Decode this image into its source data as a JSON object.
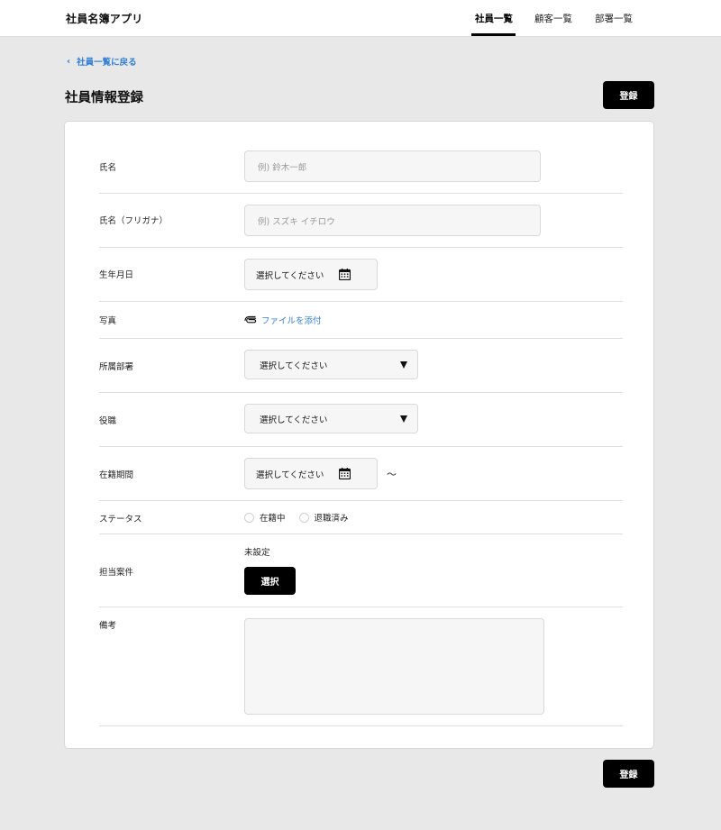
{
  "header": {
    "app_title": "社員名簿アプリ",
    "tabs": [
      {
        "label": "社員一覧",
        "active": true
      },
      {
        "label": "顧客一覧",
        "active": false
      },
      {
        "label": "部署一覧",
        "active": false
      }
    ]
  },
  "back_link": {
    "icon": "chevron-left",
    "label": "社員一覧に戻る"
  },
  "page_title": "社員情報登録",
  "register_button": "登録",
  "form": {
    "name": {
      "label": "氏名",
      "placeholder": "例) 鈴木一郎"
    },
    "name_kana": {
      "label": "氏名（フリガナ）",
      "placeholder": "例) スズキ イチロウ"
    },
    "birthdate": {
      "label": "生年月日",
      "value": "選択してください",
      "icon": "calendar-icon"
    },
    "photo": {
      "label": "写真",
      "attach_label": "ファイルを添付",
      "icon": "paperclip-icon"
    },
    "department": {
      "label": "所属部署",
      "value": "選択してください"
    },
    "position": {
      "label": "役職",
      "value": "選択してください"
    },
    "tenure": {
      "label": "在籍期間",
      "start_value": "選択してください",
      "separator": "〜"
    },
    "status": {
      "label": "ステータス",
      "options": [
        "在籍中",
        "退職済み"
      ]
    },
    "projects": {
      "label": "担当案件",
      "value": "未設定",
      "button_label": "選択"
    },
    "notes": {
      "label": "備考",
      "value": ""
    }
  },
  "colors": {
    "accent": "#2f7fd4",
    "background": "#e8e8e8",
    "primary_button": "#000000"
  }
}
